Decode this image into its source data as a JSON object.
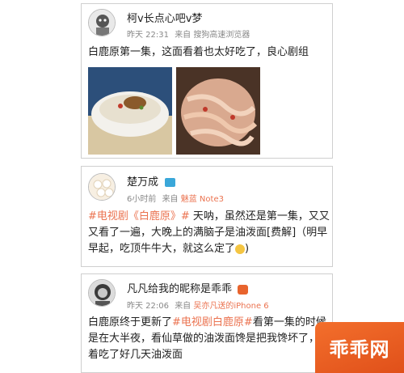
{
  "posts": [
    {
      "username": "柯v长点心吧v梦",
      "time": "昨天 22:31",
      "from_label": "来自",
      "source": "搜狗高速浏览器",
      "text": "白鹿原第一集，这面看着也太好吃了，良心剧组"
    },
    {
      "username": "楚万成",
      "time": "6小时前",
      "from_label": "来自",
      "source": "魅蓝 Note3",
      "tag": "#电视剧《白鹿原》#",
      "text": " 天呐，虽然还是第一集，又又又看了一遍，大晚上的满脑子是油泼面[费解]（明早早起，吃顶牛牛大，就这么定了"
    },
    {
      "username": "凡凡给我的昵称是乖乖",
      "time": "昨天 22:06",
      "from_label": "来自",
      "source": "吴亦凡送的iPhone 6",
      "text_before": "白鹿原终于更新了",
      "tag": "#电视剧白鹿原#",
      "text_after": "看第一集的时候是在大半夜，看仙草做的油泼面馋是把我馋坏了，连着吃了好几天油泼面"
    }
  ],
  "watermark": "乖乖网",
  "colors": {
    "accent": "#eb7350",
    "watermark_bg": "#f36f2c"
  }
}
